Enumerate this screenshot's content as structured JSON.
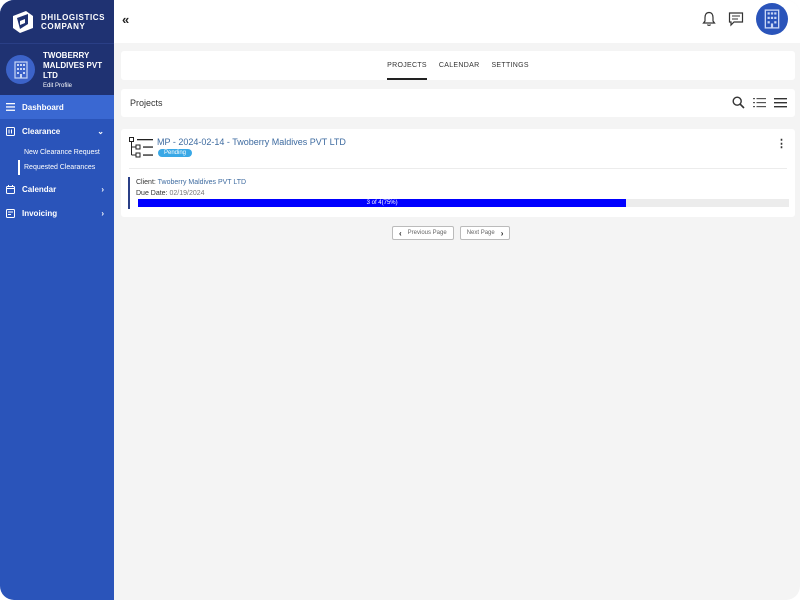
{
  "brand": {
    "line1": "DHILOGISTICS",
    "line2": "COMPANY"
  },
  "profile": {
    "name_line1": "TWOBERRY",
    "name_line2": "MALDIVES PVT",
    "name_line3": "LTD",
    "edit_label": "Edit Profile"
  },
  "sidebar": {
    "dashboard": "Dashboard",
    "clearance": "Clearance",
    "sub_items": [
      "New Clearance Request",
      "Requested Clearances"
    ],
    "calendar": "Calendar",
    "invoicing": "Invoicing"
  },
  "topbar": {
    "collapse_glyph": "«"
  },
  "tabs": [
    "PROJECTS",
    "CALENDAR",
    "SETTINGS"
  ],
  "projects": {
    "title": "Projects"
  },
  "project": {
    "title": "MP - 2024-02-14 - Twoberry Maldives PVT LTD",
    "status": "Pending",
    "client_label": "Client:",
    "client_value": "Twoberry Maldives PVT LTD",
    "due_label": "Due Date:",
    "due_value": "02/19/2024",
    "progress_text": "3 of 4(75%)",
    "progress_fraction": 0.75
  },
  "pager": {
    "prev": "Previous Page",
    "next": "Next Page"
  },
  "colors": {
    "sidebar": "#2a54ba",
    "sidebar_dark": "#1f3272",
    "progress": "#0000ff",
    "badge": "#39a8e6"
  }
}
